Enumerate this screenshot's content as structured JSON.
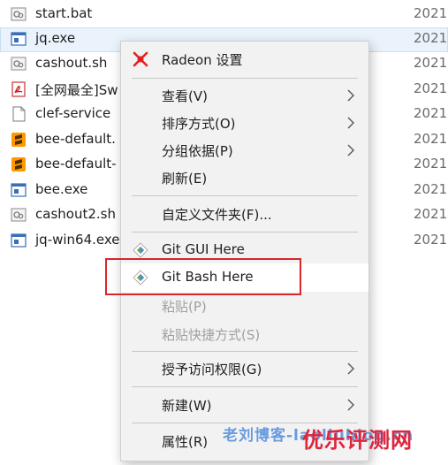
{
  "files": [
    {
      "name": "start.bat",
      "date": "2021",
      "icon": "batch-file-icon"
    },
    {
      "name": "jq.exe",
      "date": "2021",
      "icon": "exe-file-icon"
    },
    {
      "name": "cashout.sh",
      "date": "2021",
      "icon": "shell-script-icon"
    },
    {
      "name": "[全网最全]Sw",
      "date": "2021",
      "icon": "pdf-file-icon"
    },
    {
      "name": "clef-service",
      "date": "2021",
      "icon": "blank-file-icon"
    },
    {
      "name": "bee-default.",
      "date": "2021",
      "icon": "sublime-file-icon"
    },
    {
      "name": "bee-default-",
      "date": "2021",
      "icon": "sublime-file-icon"
    },
    {
      "name": "bee.exe",
      "date": "2021",
      "icon": "exe-file-icon"
    },
    {
      "name": "cashout2.sh",
      "date": "2021",
      "icon": "shell-script-icon"
    },
    {
      "name": "jq-win64.exe",
      "date": "2021",
      "icon": "exe-file-icon"
    }
  ],
  "menu": {
    "radeon": "Radeon 设置",
    "view": "查看(V)",
    "sort": "排序方式(O)",
    "group": "分组依据(P)",
    "refresh": "刷新(E)",
    "customize": "自定义文件夹(F)...",
    "git_gui": "Git GUI Here",
    "git_bash": "Git Bash Here",
    "paste": "粘贴(P)",
    "paste_shortcut": "粘贴快捷方式(S)",
    "grant_access": "授予访问权限(G)",
    "new": "新建(W)",
    "properties": "属性(R)"
  },
  "watermark": {
    "blue": "老刘博客-laoliublog.cn",
    "red": "优乐评测网"
  },
  "colors": {
    "menu_bg": "#f2f2f2",
    "highlight_red": "#d7262c",
    "selected_row": "#eaf3fb",
    "radeon_red": "#e02020"
  }
}
